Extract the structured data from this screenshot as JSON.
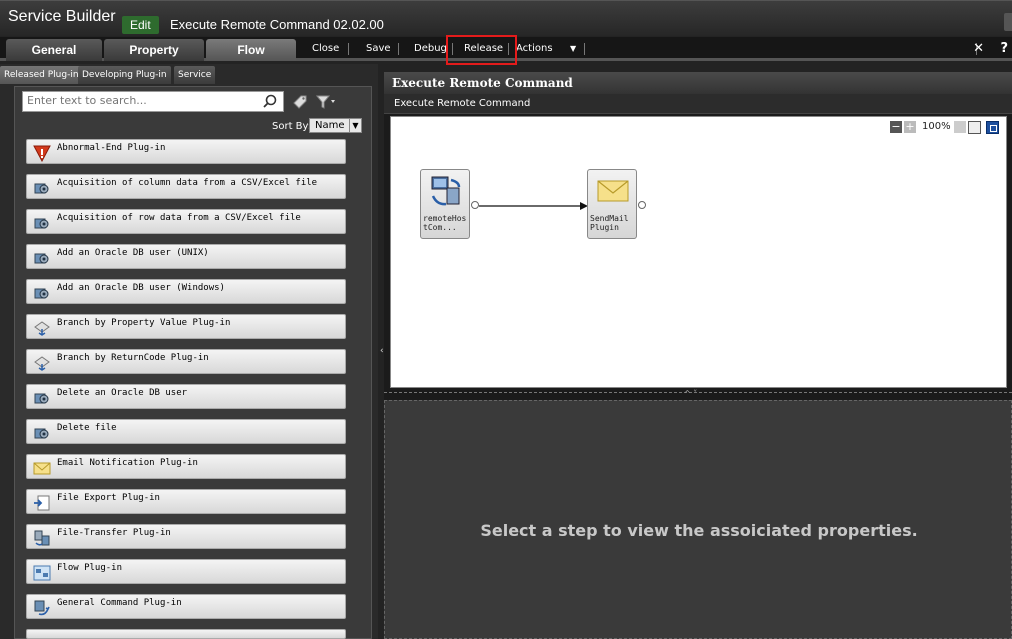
{
  "window": {
    "app_title": "Service Builder",
    "mode_badge": "Edit",
    "service_name": "Execute Remote Command 02.02.00"
  },
  "tabs": [
    {
      "label": "General"
    },
    {
      "label": "Property"
    },
    {
      "label": "Flow",
      "active": true
    }
  ],
  "toolbar": {
    "close": "Close",
    "save": "Save",
    "debug": "Debug",
    "release": "Release",
    "actions": "Actions",
    "dropdown": "▼",
    "x_icon": "✕",
    "help": "?"
  },
  "highlight_color": "#e41b1b",
  "left_panel": {
    "subtabs": [
      {
        "label": "Released Plug-in",
        "active": true
      },
      {
        "label": "Developing Plug-in"
      },
      {
        "label": "Service"
      }
    ],
    "search": {
      "placeholder": "Enter text to search..."
    },
    "sort": {
      "label": "Sort By:",
      "value": "Name"
    },
    "plugins": [
      {
        "label": "Abnormal-End Plug-in",
        "icon": "abnormal-end-icon"
      },
      {
        "label": "Acquisition of column data from a CSV/Excel file",
        "icon": "csv-column-icon"
      },
      {
        "label": "Acquisition of row data from a CSV/Excel file",
        "icon": "csv-row-icon"
      },
      {
        "label": "Add an Oracle DB user (UNIX)",
        "icon": "oracle-user-icon"
      },
      {
        "label": "Add an Oracle DB user (Windows)",
        "icon": "oracle-user-icon"
      },
      {
        "label": "Branch by Property Value Plug-in",
        "icon": "branch-property-icon"
      },
      {
        "label": "Branch by ReturnCode Plug-in",
        "icon": "branch-returncode-icon"
      },
      {
        "label": "Delete an Oracle DB user",
        "icon": "oracle-user-icon"
      },
      {
        "label": "Delete file",
        "icon": "delete-file-icon"
      },
      {
        "label": "Email Notification Plug-in",
        "icon": "email-icon"
      },
      {
        "label": "File Export Plug-in",
        "icon": "file-export-icon"
      },
      {
        "label": "File-Transfer Plug-in",
        "icon": "file-transfer-icon"
      },
      {
        "label": "Flow Plug-in",
        "icon": "flow-icon"
      },
      {
        "label": "General Command Plug-in",
        "icon": "general-command-icon"
      },
      {
        "label": "",
        "icon": ""
      }
    ]
  },
  "right_panel": {
    "header": "Execute Remote Command",
    "breadcrumb": "Execute Remote Command",
    "zoom": "100%",
    "nodes": [
      {
        "label": "remoteHostCom...",
        "icon": "remote-command-icon"
      },
      {
        "label": "SendMail Plugin",
        "icon": "email-icon"
      }
    ],
    "properties_message": "Select a step to view the assoiciated properties."
  }
}
